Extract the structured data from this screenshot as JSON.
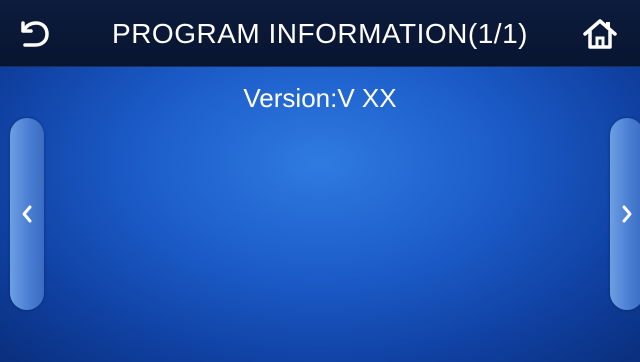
{
  "header": {
    "title": "PROGRAM INFORMATION(1/1)",
    "back_icon": "back-arrow-icon",
    "home_icon": "home-icon"
  },
  "content": {
    "version_text": "Version:V XX"
  },
  "nav": {
    "prev_icon": "chevron-left-icon",
    "next_icon": "chevron-right-icon"
  },
  "colors": {
    "header_bg": "#0d1b3d",
    "screen_bg": "#1c5cc9",
    "text": "#ffffff",
    "side_tab": "#5a8fdc"
  }
}
